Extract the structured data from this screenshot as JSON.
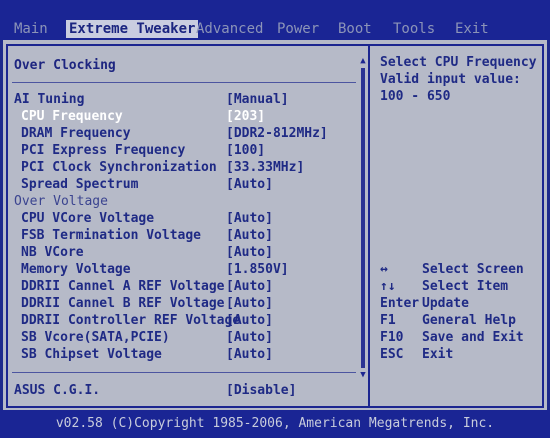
{
  "menu": {
    "tabs": [
      {
        "label": "Main"
      },
      {
        "label": "Extreme Tweaker"
      },
      {
        "label": "Advanced"
      },
      {
        "label": "Power"
      },
      {
        "label": "Boot"
      },
      {
        "label": "Tools"
      },
      {
        "label": "Exit"
      }
    ],
    "active_tab": "Extreme Tweaker"
  },
  "section": {
    "title": "Over Clocking"
  },
  "settings": [
    {
      "label": "AI Tuning",
      "value": "[Manual]"
    },
    {
      "label": "CPU Frequency",
      "value": "[203]",
      "selected": true
    },
    {
      "label": "DRAM Frequency",
      "value": "[DDR2-812MHz]"
    },
    {
      "label": "PCI Express Frequency",
      "value": "[100]"
    },
    {
      "label": "PCI Clock Synchronization",
      "value": "[33.33MHz]"
    },
    {
      "label": "Spread Spectrum",
      "value": "[Auto]"
    },
    {
      "label": "Over Voltage",
      "value": ""
    },
    {
      "label": "CPU VCore Voltage",
      "value": "[Auto]"
    },
    {
      "label": "FSB Termination Voltage",
      "value": "[Auto]"
    },
    {
      "label": "NB VCore",
      "value": "[Auto]"
    },
    {
      "label": "Memory Voltage",
      "value": "[1.850V]"
    },
    {
      "label": "DDRII Cannel A REF Voltage",
      "value": "[Auto]"
    },
    {
      "label": "DDRII Cannel B REF Voltage",
      "value": "[Auto]"
    },
    {
      "label": "DDRII Controller REF Voltage",
      "value": "[Auto]"
    },
    {
      "label": "SB Vcore(SATA,PCIE)",
      "value": "[Auto]"
    },
    {
      "label": "SB Chipset Voltage",
      "value": "[Auto]"
    }
  ],
  "cgi": {
    "label": "ASUS C.G.I.",
    "value": "[Disable]"
  },
  "help": {
    "line1": "Select CPU Frequency",
    "line2": "Valid input value:",
    "line3": "100 - 650"
  },
  "keys": [
    {
      "key": "↔",
      "desc": "Select Screen"
    },
    {
      "key": "↑↓",
      "desc": "Select Item"
    },
    {
      "key": "Enter",
      "desc": "Update"
    },
    {
      "key": "F1",
      "desc": "General Help"
    },
    {
      "key": "F10",
      "desc": "Save and Exit"
    },
    {
      "key": "ESC",
      "desc": "Exit"
    }
  ],
  "footer": {
    "text": "v02.58 (C)Copyright 1985-2006, American Megatrends, Inc."
  },
  "colors": {
    "background": "#1e2a8c",
    "panel": "#b6bac8",
    "text": "#1f2a85",
    "selected_text": "#ffffff"
  }
}
